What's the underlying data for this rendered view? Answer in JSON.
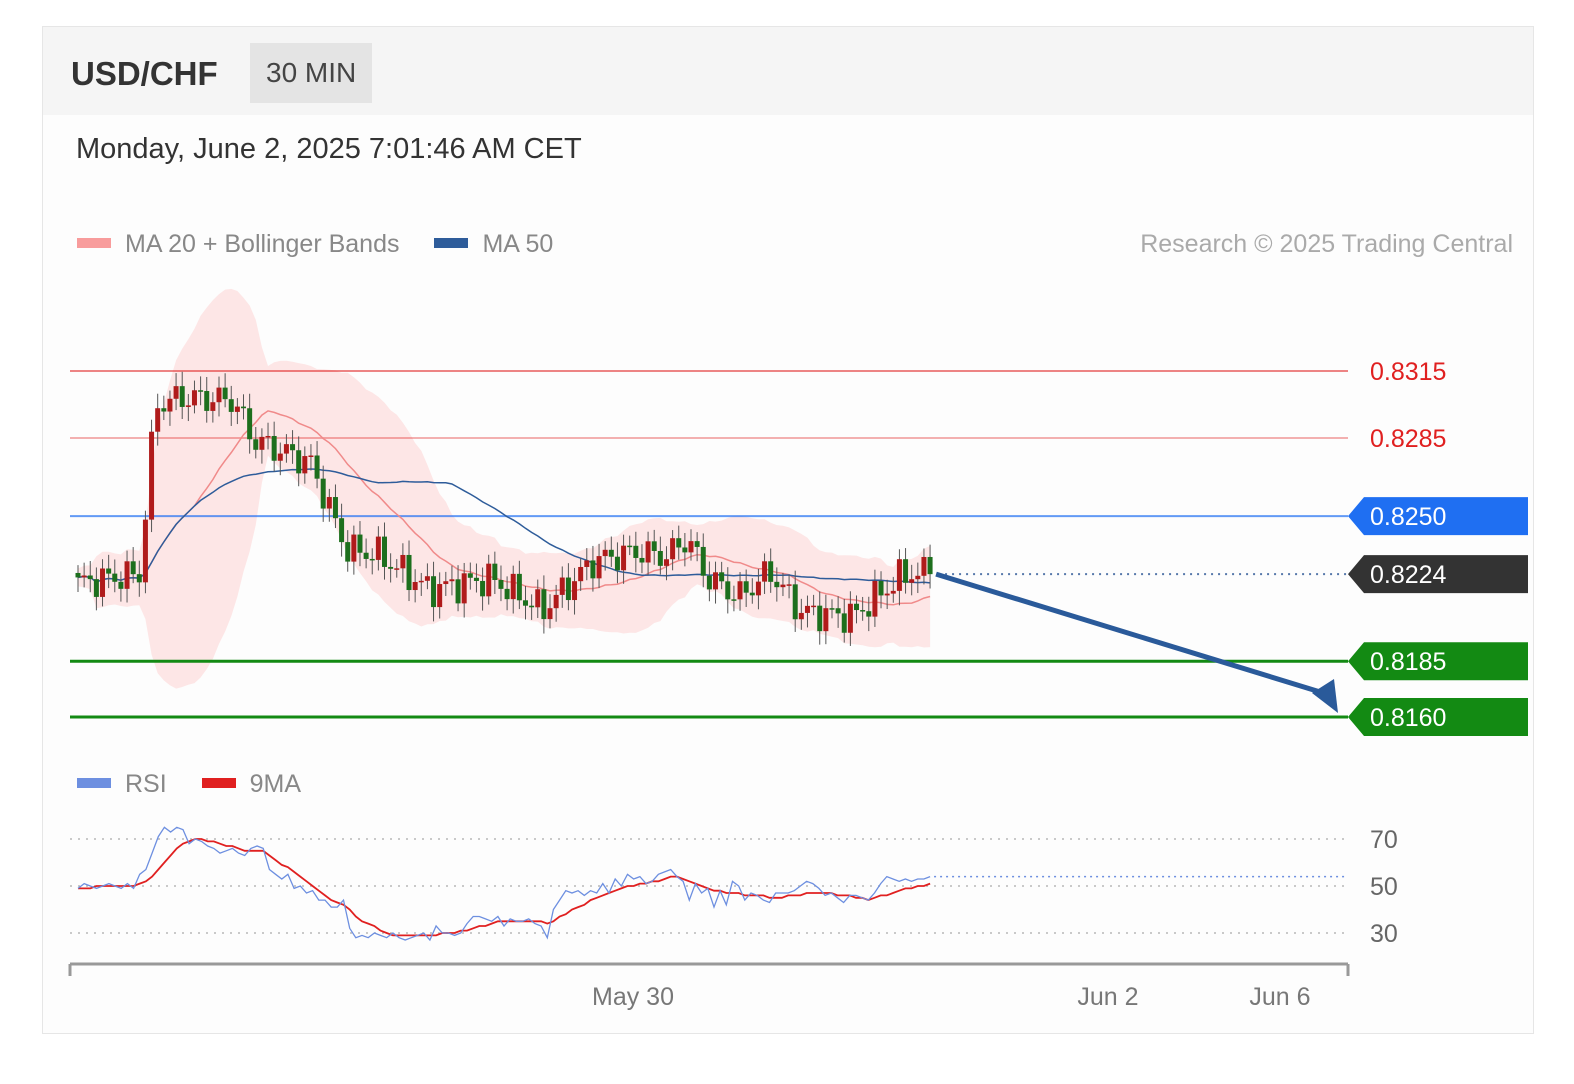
{
  "header": {
    "symbol": "USD/CHF",
    "timeframe": "30 MIN",
    "datetime": "Monday, June 2, 2025 7:01:46 AM CET",
    "copyright": "Research © 2025 Trading Central"
  },
  "legend": {
    "ma20_label": "MA 20 + Bollinger Bands",
    "ma20_color": "#f89c9c",
    "ma50_label": "MA 50",
    "ma50_color": "#2e5c9a"
  },
  "rsi_legend": {
    "rsi_label": "RSI",
    "rsi_color": "#6d8fe0",
    "ma9_label": "9MA",
    "ma9_color": "#e02020"
  },
  "chart_data": {
    "type": "candlestick",
    "ylim": [
      0.8143,
      0.837
    ],
    "resistances": [
      {
        "value": 0.8315,
        "label": "0.8315",
        "color": "#e02020"
      },
      {
        "value": 0.8285,
        "label": "0.8285",
        "color": "#e02020"
      }
    ],
    "pivot": {
      "value": 0.825,
      "label": "0.8250",
      "color": "#1f6ff2"
    },
    "last_price": {
      "value": 0.8224,
      "label": "0.8224",
      "color": "#333333"
    },
    "supports": [
      {
        "value": 0.8185,
        "label": "0.8185",
        "color": "#138a13"
      },
      {
        "value": 0.816,
        "label": "0.8160",
        "color": "#138a13"
      }
    ],
    "x_tick_labels": [
      "May 30",
      "Jun 2",
      "Jun 6"
    ],
    "rsi": {
      "ylim": [
        18,
        80
      ],
      "levels": [
        70,
        50,
        30
      ],
      "level_labels": [
        "70",
        "50",
        "30"
      ],
      "rsi_values": [
        49,
        51,
        50,
        49,
        50,
        51,
        50,
        49,
        51,
        49,
        55,
        57,
        64,
        71,
        75,
        73,
        75,
        74,
        68,
        70,
        69,
        67,
        66,
        64,
        65,
        66,
        64,
        63,
        66,
        67,
        66,
        57,
        55,
        53,
        55,
        49,
        50,
        47,
        48,
        44,
        44,
        41,
        41,
        44,
        32,
        28,
        29,
        28,
        30,
        29,
        28,
        30,
        28,
        27,
        28,
        29,
        30,
        27,
        33,
        30,
        30,
        29,
        30,
        34,
        37,
        37,
        36,
        35,
        37,
        33,
        36,
        35,
        35,
        36,
        34,
        33,
        28,
        40,
        44,
        48,
        47,
        48,
        46,
        48,
        47,
        51,
        47,
        53,
        50,
        55,
        53,
        54,
        51,
        52,
        55,
        56,
        57,
        54,
        52,
        44,
        51,
        47,
        49,
        41,
        48,
        42,
        52,
        50,
        44,
        47,
        46,
        44,
        43,
        47,
        47,
        47,
        48,
        50,
        52,
        51,
        49,
        46,
        47,
        45,
        43,
        46,
        46,
        45,
        44,
        47,
        51,
        54,
        53,
        52,
        53,
        52,
        53,
        53,
        54
      ],
      "ma9_values": [
        49,
        49,
        49,
        50,
        50,
        50,
        50,
        50,
        50,
        50,
        51,
        52,
        54,
        57,
        60,
        63,
        66,
        68,
        69,
        70,
        70,
        69,
        69,
        68,
        67,
        67,
        66,
        65,
        65,
        65,
        65,
        63,
        61,
        59,
        58,
        56,
        54,
        52,
        50,
        48,
        46,
        44,
        43,
        42,
        40,
        37,
        35,
        34,
        33,
        31,
        30,
        29,
        29,
        29,
        29,
        29,
        29,
        29,
        29,
        30,
        30,
        30,
        31,
        31,
        32,
        33,
        33,
        34,
        35,
        35,
        35,
        35,
        35,
        35,
        35,
        35,
        34,
        35,
        37,
        38,
        40,
        41,
        42,
        44,
        45,
        46,
        47,
        48,
        49,
        50,
        50,
        51,
        51,
        52,
        52,
        53,
        54,
        54,
        53,
        52,
        51,
        50,
        49,
        48,
        48,
        47,
        47,
        47,
        46,
        46,
        46,
        46,
        45,
        45,
        45,
        46,
        46,
        46,
        47,
        47,
        47,
        47,
        47,
        46,
        46,
        46,
        45,
        45,
        44,
        45,
        46,
        46,
        47,
        48,
        49,
        49,
        50,
        50,
        51
      ]
    }
  }
}
